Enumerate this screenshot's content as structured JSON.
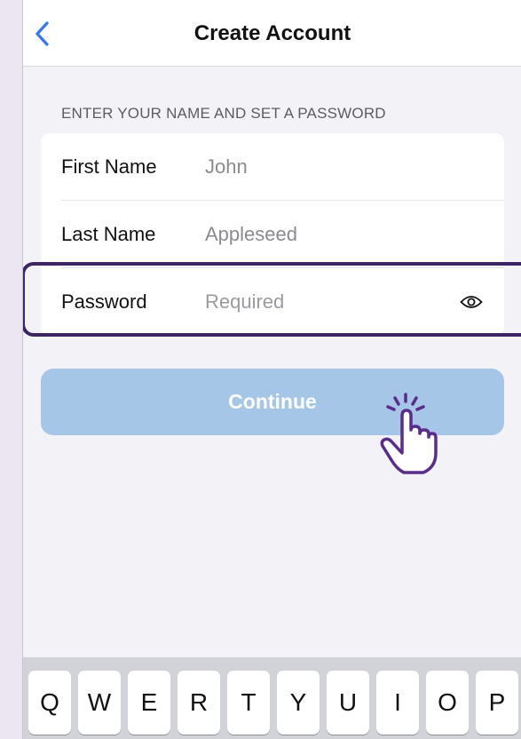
{
  "navbar": {
    "title": "Create Account",
    "back_icon": "chevron-left-icon"
  },
  "form": {
    "section_header": "ENTER YOUR NAME AND SET A PASSWORD",
    "first_name": {
      "label": "First Name",
      "value": "John"
    },
    "last_name": {
      "label": "Last Name",
      "value": "Appleseed"
    },
    "password": {
      "label": "Password",
      "placeholder": "Required",
      "toggle_icon": "eye-icon"
    }
  },
  "continue_button": {
    "label": "Continue",
    "enabled": false
  },
  "keyboard": {
    "keys": [
      "Q",
      "W",
      "E",
      "R",
      "T",
      "Y",
      "U",
      "I",
      "O",
      "P"
    ]
  },
  "colors": {
    "accent": "#3478f6",
    "button_disabled": "#a6c6e8",
    "highlight": "#3d2566",
    "cursor_hint": "#5a2d8c"
  }
}
